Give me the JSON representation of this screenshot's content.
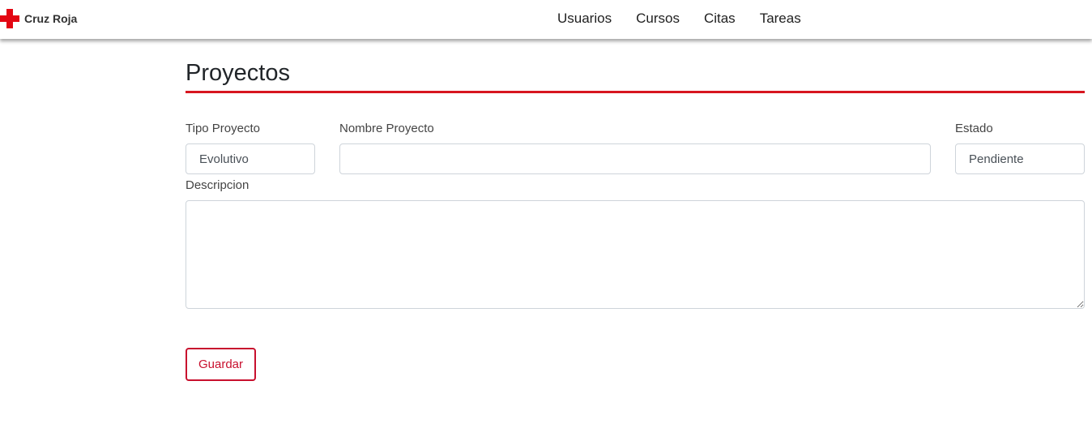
{
  "header": {
    "brand": "Cruz Roja",
    "nav": [
      "Usuarios",
      "Cursos",
      "Citas",
      "Tareas"
    ]
  },
  "colors": {
    "accent": "#d7161f",
    "button": "#c8102e"
  },
  "main": {
    "title": "Proyectos",
    "form": {
      "tipo_label": "Tipo Proyecto",
      "tipo_value": "Evolutivo",
      "nombre_label": "Nombre Proyecto",
      "nombre_value": "",
      "estado_label": "Estado",
      "estado_value": "Pendiente",
      "descripcion_label": "Descripcion",
      "descripcion_value": "",
      "save_label": "Guardar"
    }
  }
}
